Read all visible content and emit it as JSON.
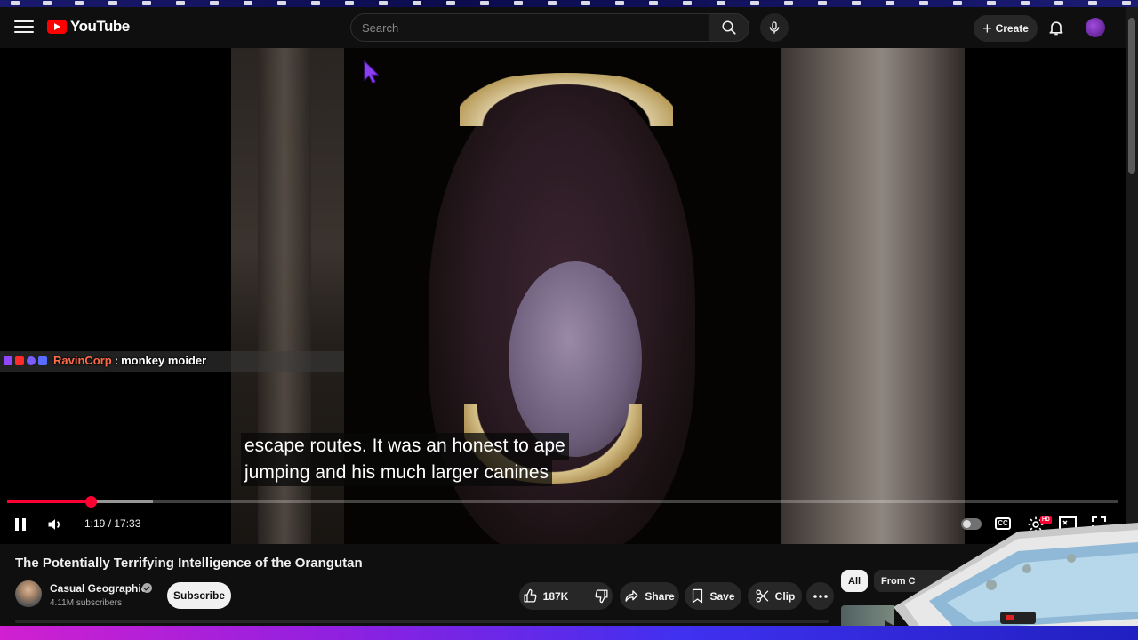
{
  "header": {
    "logo_text": "YouTube",
    "search_placeholder": "Search",
    "create_label": "Create"
  },
  "player": {
    "chat": {
      "user": "RavinCorp",
      "separator": ":",
      "message": "monkey moider"
    },
    "captions": [
      "escape routes. It was an honest to ape",
      "jumping and his much larger canines"
    ],
    "time_current": "1:19",
    "time_total": "17:33",
    "time_display": "1:19 / 17:33",
    "progress_played_fraction": 0.0751,
    "progress_buffered_fraction": 0.131,
    "cc_label": "CC",
    "hd_badge": "HD"
  },
  "video": {
    "title": "The Potentially Terrifying Intelligence of the Orangutan",
    "channel_name": "Casual Geographic",
    "subscribers": "4.11M subscribers",
    "subscribe_label": "Subscribe",
    "like_count": "187K",
    "share_label": "Share",
    "save_label": "Save",
    "clip_label": "Clip"
  },
  "sidebar": {
    "chips": [
      "All",
      "From C"
    ]
  },
  "colors": {
    "accent": "#ff0033",
    "background": "#0f0f0f",
    "chat_user": "#ff6b4a"
  }
}
